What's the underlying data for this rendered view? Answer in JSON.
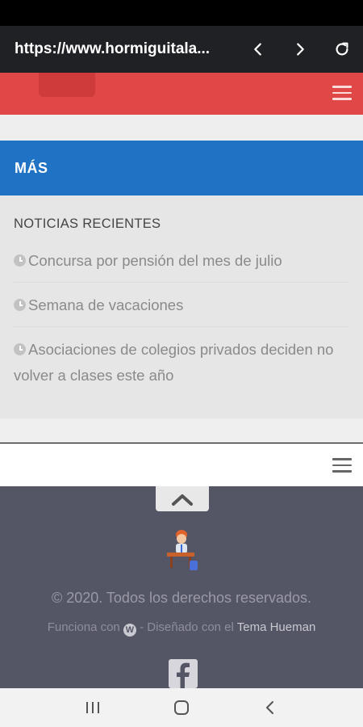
{
  "browser": {
    "url": "https://www.hormiguitala..."
  },
  "sidebar": {
    "section_title": "MÁS",
    "recent_title": "NOTICIAS RECIENTES",
    "posts": [
      {
        "title": "Concursa por pensión del mes de julio"
      },
      {
        "title": "Semana de vacaciones"
      },
      {
        "title": "Asociaciones de colegios privados deciden no volver a clases este año"
      }
    ]
  },
  "footer": {
    "copyright": "© 2020. Todos los derechos reservados.",
    "powered_prefix": "Funciona con",
    "designed_text": "- Diseñado con el",
    "theme_link": "Tema Hueman"
  },
  "colors": {
    "header_red": "#e04848",
    "section_blue": "#1f72c4",
    "footer_bg": "#545565"
  },
  "icons": [
    "back-icon",
    "forward-icon",
    "reload-icon",
    "menu-icon",
    "clock-icon",
    "chevron-up-icon",
    "wordpress-icon",
    "facebook-icon",
    "recent-apps-icon",
    "home-icon",
    "back-nav-icon"
  ]
}
